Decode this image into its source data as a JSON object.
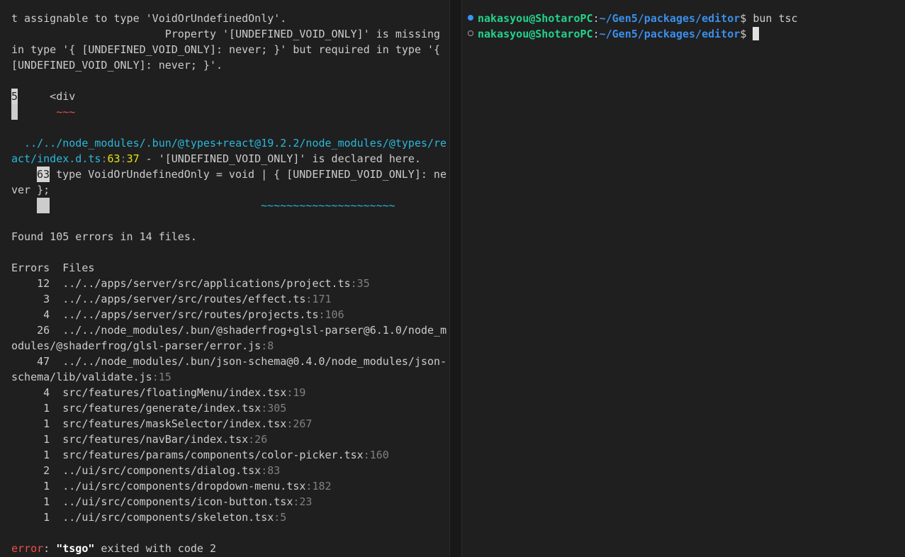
{
  "left_terminal": {
    "msg_line1": "t assignable to type 'VoidOrUndefinedOnly'.",
    "msg_line2": "                        Property '[UNDEFINED_VOID_ONLY]' is missing",
    "msg_line3": "in type '{ [UNDEFINED_VOID_ONLY]: never; }' but required in type '{",
    "msg_line4": "[UNDEFINED_VOID_ONLY]: never; }'.",
    "code_line_no": "5",
    "code_line_text": "     <div",
    "code_squiggle": "~~~",
    "decl_path_line1": "  ../../node_modules/.bun/@types+react@19.2.2/node_modules/@types/re",
    "decl_path_line2": "act/index.d.ts",
    "decl_sep1": ":",
    "decl_line": "63",
    "decl_sep2": ":",
    "decl_col": "37",
    "decl_msg": " - '[UNDEFINED_VOID_ONLY]' is declared here.",
    "decl_code_line_no": "63",
    "decl_code_text1": " type VoidOrUndefinedOnly = void | { [UNDEFINED_VOID_ONLY]: ne",
    "decl_code_text2": "ver };",
    "decl_squiggle": "~~~~~~~~~~~~~~~~~~~~~",
    "summary": "Found 105 errors in 14 files.",
    "errors_header": "Errors  Files",
    "files": [
      {
        "count": "    12",
        "path": "../../apps/server/src/applications/project.ts",
        "line": ":35"
      },
      {
        "count": "     3",
        "path": "../../apps/server/src/routes/effect.ts",
        "line": ":171"
      },
      {
        "count": "     4",
        "path": "../../apps/server/src/routes/projects.ts",
        "line": ":106"
      },
      {
        "count": "    26",
        "path": "../../node_modules/.bun/@shaderfrog+glsl-parser@6.1.0/node_m",
        "path2": "odules/@shaderfrog/glsl-parser/error.js",
        "line": ":8"
      },
      {
        "count": "    47",
        "path": "../../node_modules/.bun/json-schema@0.4.0/node_modules/json-",
        "path2": "schema/lib/validate.js",
        "line": ":15"
      },
      {
        "count": "     4",
        "path": "src/features/floatingMenu/index.tsx",
        "line": ":19"
      },
      {
        "count": "     1",
        "path": "src/features/generate/index.tsx",
        "line": ":305"
      },
      {
        "count": "     1",
        "path": "src/features/maskSelector/index.tsx",
        "line": ":267"
      },
      {
        "count": "     1",
        "path": "src/features/navBar/index.tsx",
        "line": ":26"
      },
      {
        "count": "     1",
        "path": "src/features/params/components/color-picker.tsx",
        "line": ":160"
      },
      {
        "count": "     2",
        "path": "../ui/src/components/dialog.tsx",
        "line": ":83"
      },
      {
        "count": "     1",
        "path": "../ui/src/components/dropdown-menu.tsx",
        "line": ":182"
      },
      {
        "count": "     1",
        "path": "../ui/src/components/icon-button.tsx",
        "line": ":23"
      },
      {
        "count": "     1",
        "path": "../ui/src/components/skeleton.tsx",
        "line": ":5"
      }
    ],
    "exit_label": "error",
    "exit_colon": ": ",
    "exit_cmd": "\"tsgo\"",
    "exit_msg": " exited with code 2"
  },
  "right_terminal": {
    "user_host": "nakasyou@ShotaroPC",
    "sep": ":",
    "cwd": "~/Gen5/packages/editor",
    "prompt_char": "$ ",
    "command1": "bun tsc",
    "command2": ""
  },
  "colors": {
    "background": "#1f1f1f",
    "error_red": "#f14c4c",
    "path_cyan": "#29b8db",
    "prompt_green": "#23d18b",
    "prompt_blue": "#3b8eea",
    "status_dot_blue": "#3794ff"
  },
  "icons": {
    "command_success_dot": "filled-circle",
    "command_pending_dot": "hollow-circle",
    "cursor": "block-cursor"
  }
}
